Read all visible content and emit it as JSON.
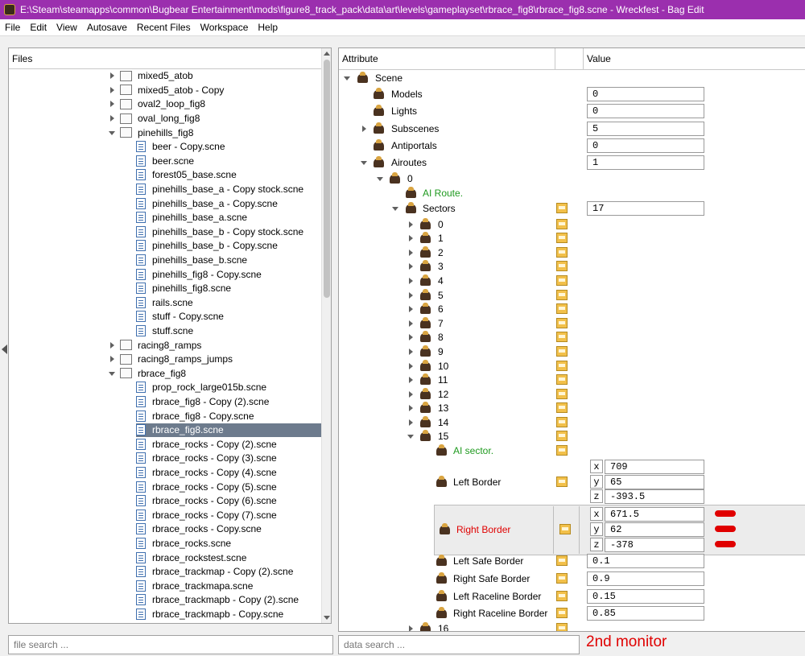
{
  "window": {
    "title": "E:\\Steam\\steamapps\\common\\Bugbear Entertainment\\mods\\figure8_track_pack\\data\\art\\levels\\gameplayset\\rbrace_fig8\\rbrace_fig8.scne - Wreckfest - Bag Edit"
  },
  "menu": [
    "File",
    "Edit",
    "View",
    "Autosave",
    "Recent Files",
    "Workspace",
    "Help"
  ],
  "files_panel": {
    "header": "Files",
    "search_placeholder": "file search ...",
    "items": [
      {
        "label": "mixed5_atob",
        "type": "folder",
        "expanded": false
      },
      {
        "label": "mixed5_atob - Copy",
        "type": "folder",
        "expanded": false
      },
      {
        "label": "oval2_loop_fig8",
        "type": "folder",
        "expanded": false
      },
      {
        "label": "oval_long_fig8",
        "type": "folder",
        "expanded": false
      },
      {
        "label": "pinehills_fig8",
        "type": "folder",
        "expanded": true
      },
      {
        "label": "beer - Copy.scne",
        "type": "file"
      },
      {
        "label": "beer.scne",
        "type": "file"
      },
      {
        "label": "forest05_base.scne",
        "type": "file"
      },
      {
        "label": "pinehills_base_a - Copy stock.scne",
        "type": "file"
      },
      {
        "label": "pinehills_base_a - Copy.scne",
        "type": "file"
      },
      {
        "label": "pinehills_base_a.scne",
        "type": "file"
      },
      {
        "label": "pinehills_base_b - Copy stock.scne",
        "type": "file"
      },
      {
        "label": "pinehills_base_b - Copy.scne",
        "type": "file"
      },
      {
        "label": "pinehills_base_b.scne",
        "type": "file"
      },
      {
        "label": "pinehills_fig8 - Copy.scne",
        "type": "file"
      },
      {
        "label": "pinehills_fig8.scne",
        "type": "file"
      },
      {
        "label": "rails.scne",
        "type": "file"
      },
      {
        "label": "stuff - Copy.scne",
        "type": "file"
      },
      {
        "label": "stuff.scne",
        "type": "file"
      },
      {
        "label": "racing8_ramps",
        "type": "folder",
        "expanded": false
      },
      {
        "label": "racing8_ramps_jumps",
        "type": "folder",
        "expanded": false
      },
      {
        "label": "rbrace_fig8",
        "type": "folder",
        "expanded": true
      },
      {
        "label": "prop_rock_large015b.scne",
        "type": "file"
      },
      {
        "label": "rbrace_fig8 - Copy (2).scne",
        "type": "file"
      },
      {
        "label": "rbrace_fig8 - Copy.scne",
        "type": "file"
      },
      {
        "label": "rbrace_fig8.scne",
        "type": "file",
        "selected": true
      },
      {
        "label": "rbrace_rocks - Copy (2).scne",
        "type": "file"
      },
      {
        "label": "rbrace_rocks - Copy (3).scne",
        "type": "file"
      },
      {
        "label": "rbrace_rocks - Copy (4).scne",
        "type": "file"
      },
      {
        "label": "rbrace_rocks - Copy (5).scne",
        "type": "file"
      },
      {
        "label": "rbrace_rocks - Copy (6).scne",
        "type": "file"
      },
      {
        "label": "rbrace_rocks - Copy (7).scne",
        "type": "file"
      },
      {
        "label": "rbrace_rocks - Copy.scne",
        "type": "file"
      },
      {
        "label": "rbrace_rocks.scne",
        "type": "file"
      },
      {
        "label": "rbrace_rockstest.scne",
        "type": "file"
      },
      {
        "label": "rbrace_trackmap - Copy (2).scne",
        "type": "file"
      },
      {
        "label": "rbrace_trackmapa.scne",
        "type": "file"
      },
      {
        "label": "rbrace_trackmapb - Copy (2).scne",
        "type": "file"
      },
      {
        "label": "rbrace_trackmapb - Copy.scne",
        "type": "file"
      },
      {
        "label": "rbrace_trackmapb.scne",
        "type": "file"
      }
    ]
  },
  "attr_panel": {
    "header_attribute": "Attribute",
    "header_value": "Value",
    "search_placeholder": "data search ...",
    "rows": [
      {
        "label": "Scene",
        "arrow": "expanded"
      },
      {
        "label": "Models",
        "value": "0"
      },
      {
        "label": "Lights",
        "value": "0"
      },
      {
        "label": "Subscenes",
        "value": "5",
        "arrow": "collapsed"
      },
      {
        "label": "Antiportals",
        "value": "0"
      },
      {
        "label": "Airoutes",
        "value": "1",
        "arrow": "expanded"
      },
      {
        "label": "0",
        "arrow": "expanded"
      },
      {
        "label": "AI Route.",
        "color": "green"
      },
      {
        "label": "Sectors",
        "value": "17",
        "arrow": "expanded",
        "save": true
      },
      {
        "label": "0",
        "arrow": "collapsed",
        "save": true
      },
      {
        "label": "1",
        "arrow": "collapsed",
        "save": true
      },
      {
        "label": "2",
        "arrow": "collapsed",
        "save": true
      },
      {
        "label": "3",
        "arrow": "collapsed",
        "save": true
      },
      {
        "label": "4",
        "arrow": "collapsed",
        "save": true
      },
      {
        "label": "5",
        "arrow": "collapsed",
        "save": true
      },
      {
        "label": "6",
        "arrow": "collapsed",
        "save": true
      },
      {
        "label": "7",
        "arrow": "collapsed",
        "save": true
      },
      {
        "label": "8",
        "arrow": "collapsed",
        "save": true
      },
      {
        "label": "9",
        "arrow": "collapsed",
        "save": true
      },
      {
        "label": "10",
        "arrow": "collapsed",
        "save": true
      },
      {
        "label": "11",
        "arrow": "collapsed",
        "save": true
      },
      {
        "label": "12",
        "arrow": "collapsed",
        "save": true
      },
      {
        "label": "13",
        "arrow": "collapsed",
        "save": true
      },
      {
        "label": "14",
        "arrow": "collapsed",
        "save": true
      },
      {
        "label": "15",
        "arrow": "expanded",
        "save": true
      },
      {
        "label": "AI sector.",
        "color": "green",
        "save": true
      }
    ],
    "left_border": {
      "label": "Left Border",
      "x": "709",
      "y": "65",
      "z": "-393.5"
    },
    "right_border": {
      "label": "Right Border",
      "x": "671.5",
      "y": "62",
      "z": "-378"
    },
    "lower_rows": [
      {
        "label": "Left Safe Border",
        "value": "0.1"
      },
      {
        "label": "Right Safe Border",
        "value": "0.9"
      },
      {
        "label": "Left Raceline Border",
        "value": "0.15"
      },
      {
        "label": "Right Raceline Border",
        "value": "0.85"
      }
    ],
    "last_row": {
      "label": "16"
    }
  },
  "annotation": "2nd monitor",
  "colors": {
    "titlebar": "#9b2fae",
    "selected_row": "#6d7b8d",
    "green_label": "#1f9a1f",
    "red_label": "#e00000"
  }
}
